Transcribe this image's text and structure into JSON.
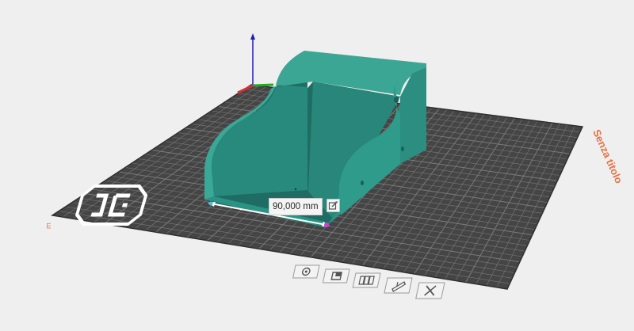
{
  "viewport": {
    "bed_name": "Senza titolo",
    "front_edge_label": "ш",
    "measurement": {
      "value_label": "90,000 mm",
      "edit_icon": "edit-icon"
    },
    "logo": "printer-brand-logo",
    "model": {
      "color": "#2a9384",
      "shape": "box-with-curved-side-walls"
    },
    "axes": {
      "z_color": "#1e1eb8",
      "x_color": "#d83030",
      "y_color": "#22aa22"
    },
    "bed_toolbar": [
      {
        "name": "target-icon"
      },
      {
        "name": "layer-icon"
      },
      {
        "name": "arrange-icon"
      },
      {
        "name": "ruler-icon"
      },
      {
        "name": "delete-icon"
      }
    ],
    "colors": {
      "accent": "#e87040",
      "bed": "#4a4a4a",
      "grid": "#7a7a7a",
      "background": "#efefef"
    }
  }
}
